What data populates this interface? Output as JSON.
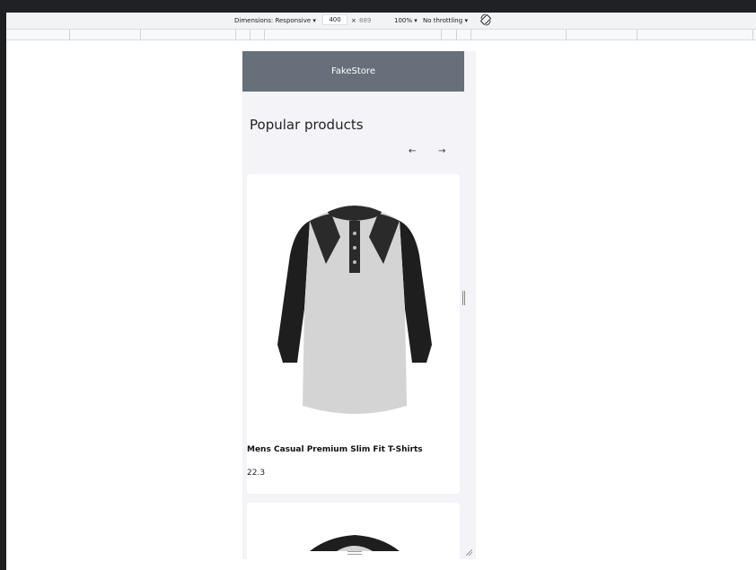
{
  "devtools": {
    "dimensions_label": "Dimensions: Responsive",
    "width_value": "400",
    "times": "×",
    "height_value": "889",
    "zoom": "100%",
    "throttling": "No throttling"
  },
  "store": {
    "brand": "FakeStore",
    "section_title": "Popular products",
    "prev_arrow": "←",
    "next_arrow": "→",
    "products": [
      {
        "title": "Mens Casual Premium Slim Fit T-Shirts",
        "price": "22.3"
      }
    ]
  },
  "colors": {
    "header_bg": "#67707a",
    "page_bg": "#f4f3f8",
    "card_bg": "#ffffff"
  }
}
